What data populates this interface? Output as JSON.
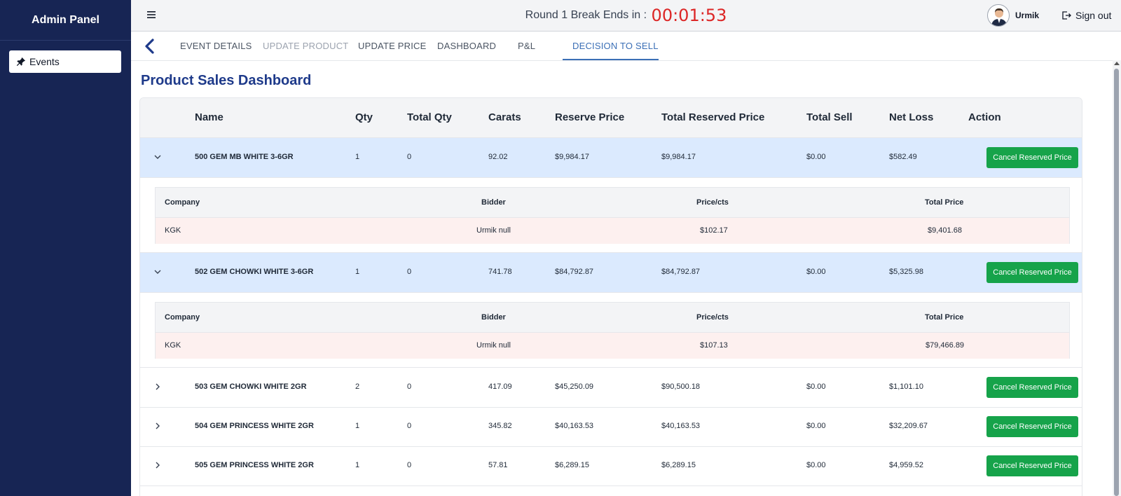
{
  "sidebar": {
    "title": "Admin Panel",
    "items": [
      {
        "label": "Events",
        "icon": "pin-icon"
      }
    ]
  },
  "topbar": {
    "timer_label": "Round 1 Break Ends in :",
    "timer_value": "00:01:53",
    "timer_color": "#dc2626",
    "user_name": "Urmik",
    "signout_label": "Sign out"
  },
  "tabs": [
    {
      "label": "EVENT DETAILS",
      "state": "normal"
    },
    {
      "label": "UPDATE PRODUCT",
      "state": "disabled"
    },
    {
      "label": "UPDATE PRICE",
      "state": "normal"
    },
    {
      "label": "DASHBOARD",
      "state": "normal"
    },
    {
      "label": "P&L",
      "state": "normal"
    },
    {
      "label": "DECISION TO SELL",
      "state": "active"
    }
  ],
  "page": {
    "title": "Product Sales Dashboard"
  },
  "table": {
    "headers": [
      "Name",
      "Qty",
      "Total Qty",
      "Carats",
      "Reserve Price",
      "Total Reserved Price",
      "Total Sell",
      "Net Loss",
      "Action"
    ],
    "sub_headers": [
      "Company",
      "Bidder",
      "Price/cts",
      "Total Price"
    ],
    "action_label": "Cancel Reserved Price",
    "rows": [
      {
        "name": "500 GEM MB WHITE 3-6GR",
        "qty": "1",
        "total_qty": "0",
        "carats": "92.02",
        "reserve_price": "$9,984.17",
        "total_reserved_price": "$9,984.17",
        "total_sell": "$0.00",
        "net_loss": "$582.49",
        "expanded": true,
        "bids": [
          {
            "company": "KGK",
            "bidder": "Urmik null",
            "price_cts": "$102.17",
            "total_price": "$9,401.68"
          }
        ]
      },
      {
        "name": "502 GEM CHOWKI WHITE 3-6GR",
        "qty": "1",
        "total_qty": "0",
        "carats": "741.78",
        "reserve_price": "$84,792.87",
        "total_reserved_price": "$84,792.87",
        "total_sell": "$0.00",
        "net_loss": "$5,325.98",
        "expanded": true,
        "bids": [
          {
            "company": "KGK",
            "bidder": "Urmik null",
            "price_cts": "$107.13",
            "total_price": "$79,466.89"
          }
        ]
      },
      {
        "name": "503 GEM CHOWKI WHITE 2GR",
        "qty": "2",
        "total_qty": "0",
        "carats": "417.09",
        "reserve_price": "$45,250.09",
        "total_reserved_price": "$90,500.18",
        "total_sell": "$0.00",
        "net_loss": "$1,101.10",
        "expanded": false
      },
      {
        "name": "504 GEM PRINCESS WHITE 2GR",
        "qty": "1",
        "total_qty": "0",
        "carats": "345.82",
        "reserve_price": "$40,163.53",
        "total_reserved_price": "$40,163.53",
        "total_sell": "$0.00",
        "net_loss": "$32,209.67",
        "expanded": false
      },
      {
        "name": "505 GEM PRINCESS WHITE 2GR",
        "qty": "1",
        "total_qty": "0",
        "carats": "57.81",
        "reserve_price": "$6,289.15",
        "total_reserved_price": "$6,289.15",
        "total_sell": "$0.00",
        "net_loss": "$4,959.52",
        "expanded": false
      }
    ]
  },
  "colors": {
    "sidebar_bg": "#172554",
    "title": "#1e3a8a",
    "accent_tab": "#3b6fb6",
    "action_button": "#16a34a",
    "expanded_row_bg": "#dbeafe",
    "bid_row_bg": "#fdf0ef"
  }
}
